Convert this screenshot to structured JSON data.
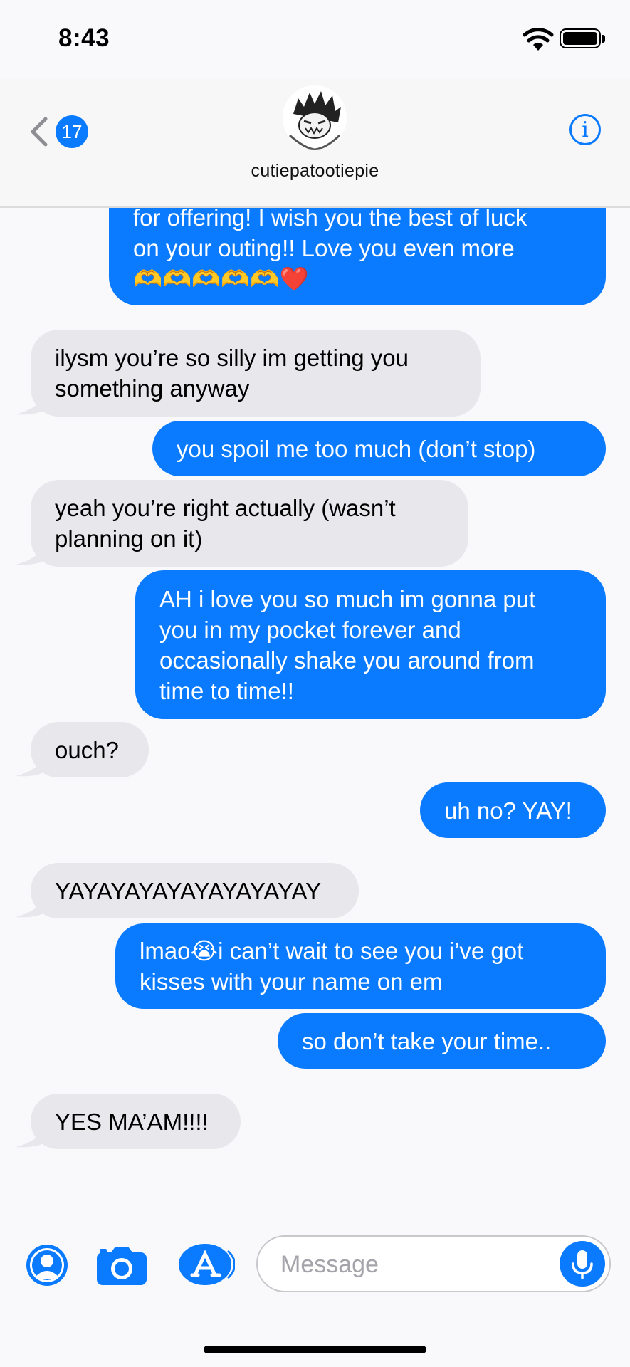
{
  "status_bar": {
    "time": "8:43"
  },
  "header": {
    "back_count": "17",
    "contact_name": "cutiepatootiepie",
    "info_glyph": "i"
  },
  "messages": [
    {
      "side": "sent",
      "text": "for offering! I wish you the best of luck\non your outing!! Love you even more\n🫶🫶🫶🫶🫶❤️"
    },
    {
      "side": "recv",
      "text": "ilysm you’re so silly im getting you\nsomething anyway"
    },
    {
      "side": "sent",
      "text": "you spoil me too much (don’t stop)"
    },
    {
      "side": "recv",
      "text": "yeah you’re right actually (wasn’t\nplanning on it)"
    },
    {
      "side": "sent",
      "text": "AH i love you so much im gonna put\nyou in my pocket forever and\noccasionally shake you around from\ntime to time!!"
    },
    {
      "side": "recv",
      "text": "ouch?"
    },
    {
      "side": "sent",
      "text": "uh no? YAY!"
    },
    {
      "side": "recv",
      "text": "YAYAYAYAYAYAYAYAYAY"
    },
    {
      "side": "sent",
      "text": "lmao😭i can’t wait to see you i’ve got\nkisses with your name on em"
    },
    {
      "side": "sent",
      "text": "so don’t take your time.."
    },
    {
      "side": "recv",
      "text": "YES MA’AM!!!!"
    }
  ],
  "composer": {
    "placeholder": "Message",
    "icons": [
      "contact-icon",
      "camera-icon",
      "app-store-icon",
      "microphone-icon"
    ]
  },
  "colors": {
    "accent": "#0a7bff",
    "received_bubble": "#e8e7ec",
    "background": "#f9f9fb"
  }
}
